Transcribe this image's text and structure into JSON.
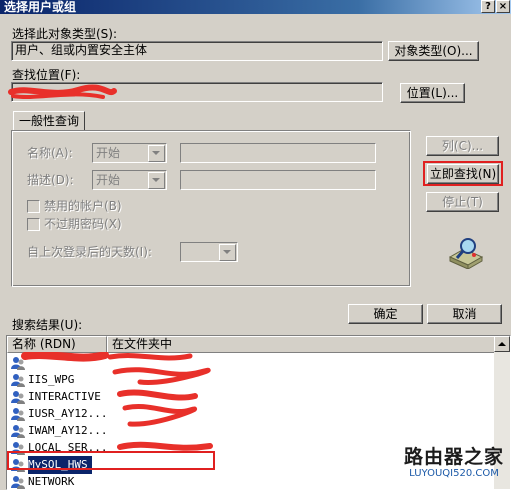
{
  "window": {
    "title": "选择用户或组",
    "help_btn": "?",
    "close_btn": "×"
  },
  "object_types": {
    "label": "选择此对象类型(S):",
    "value": "用户、组或内置安全主体",
    "button": "对象类型(O)..."
  },
  "location": {
    "label": "查找位置(F):",
    "value": "",
    "button": "位置(L)..."
  },
  "general_query": {
    "tab_label": "一般性查询",
    "name_label": "名称(A):",
    "name_mode": "开始",
    "desc_label": "描述(D):",
    "desc_mode": "开始",
    "disabled_accounts": "禁用的帐户(B)",
    "non_expiring_pwd": "不过期密码(X)",
    "days_since_logon": "自上次登录后的天数(I):"
  },
  "side_buttons": {
    "columns": "列(C)...",
    "find_now": "立即查找(N)",
    "stop": "停止(T)"
  },
  "footer": {
    "ok": "确定",
    "cancel": "取消"
  },
  "results": {
    "label": "搜索结果(U):",
    "col_name": "名称 (RDN)",
    "col_folder": "在文件夹中",
    "rows": [
      {
        "name": "",
        "folder": "",
        "selected": false
      },
      {
        "name": "IIS_WPG",
        "folder": "",
        "selected": false
      },
      {
        "name": "INTERACTIVE",
        "folder": "",
        "selected": false
      },
      {
        "name": "IUSR_AY12...",
        "folder": "",
        "selected": false
      },
      {
        "name": "IWAM_AY12...",
        "folder": "",
        "selected": false
      },
      {
        "name": "LOCAL SER...",
        "folder": "",
        "selected": false
      },
      {
        "name": "MySQL_HWS",
        "folder": "",
        "selected": true
      },
      {
        "name": "NETWORK",
        "folder": "",
        "selected": false
      }
    ]
  },
  "watermark": {
    "title": "路由器之家",
    "url": "LUYOUQI520.COM"
  }
}
